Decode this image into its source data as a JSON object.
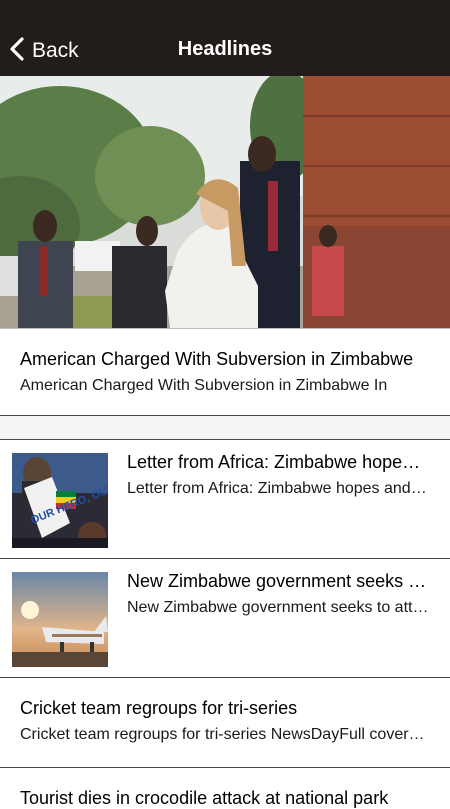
{
  "nav": {
    "back_label": "Back",
    "title": "Headlines"
  },
  "articles": [
    {
      "title": "American Charged With Subversion in Zimbabwe",
      "summary": "American Charged With Subversion in Zimbabwe In"
    },
    {
      "title": "Letter from Africa: Zimbabwe hopes and fears",
      "summary": "Letter from Africa: Zimbabwe hopes and fears",
      "sign_text": "OUR HERO, OUR HOPE"
    },
    {
      "title": "New Zimbabwe government seeks foreign",
      "summary": "New Zimbabwe government seeks to attract"
    },
    {
      "title": "Cricket team regroups for tri-series",
      "summary": "Cricket team regroups for tri-series  NewsDayFull coverage"
    },
    {
      "title": "Tourist dies in crocodile attack at national park",
      "summary": ""
    }
  ],
  "colors": {
    "navbar": "#221d1a",
    "divider": "#4a4a4a",
    "gap": "#f4f4f4"
  }
}
